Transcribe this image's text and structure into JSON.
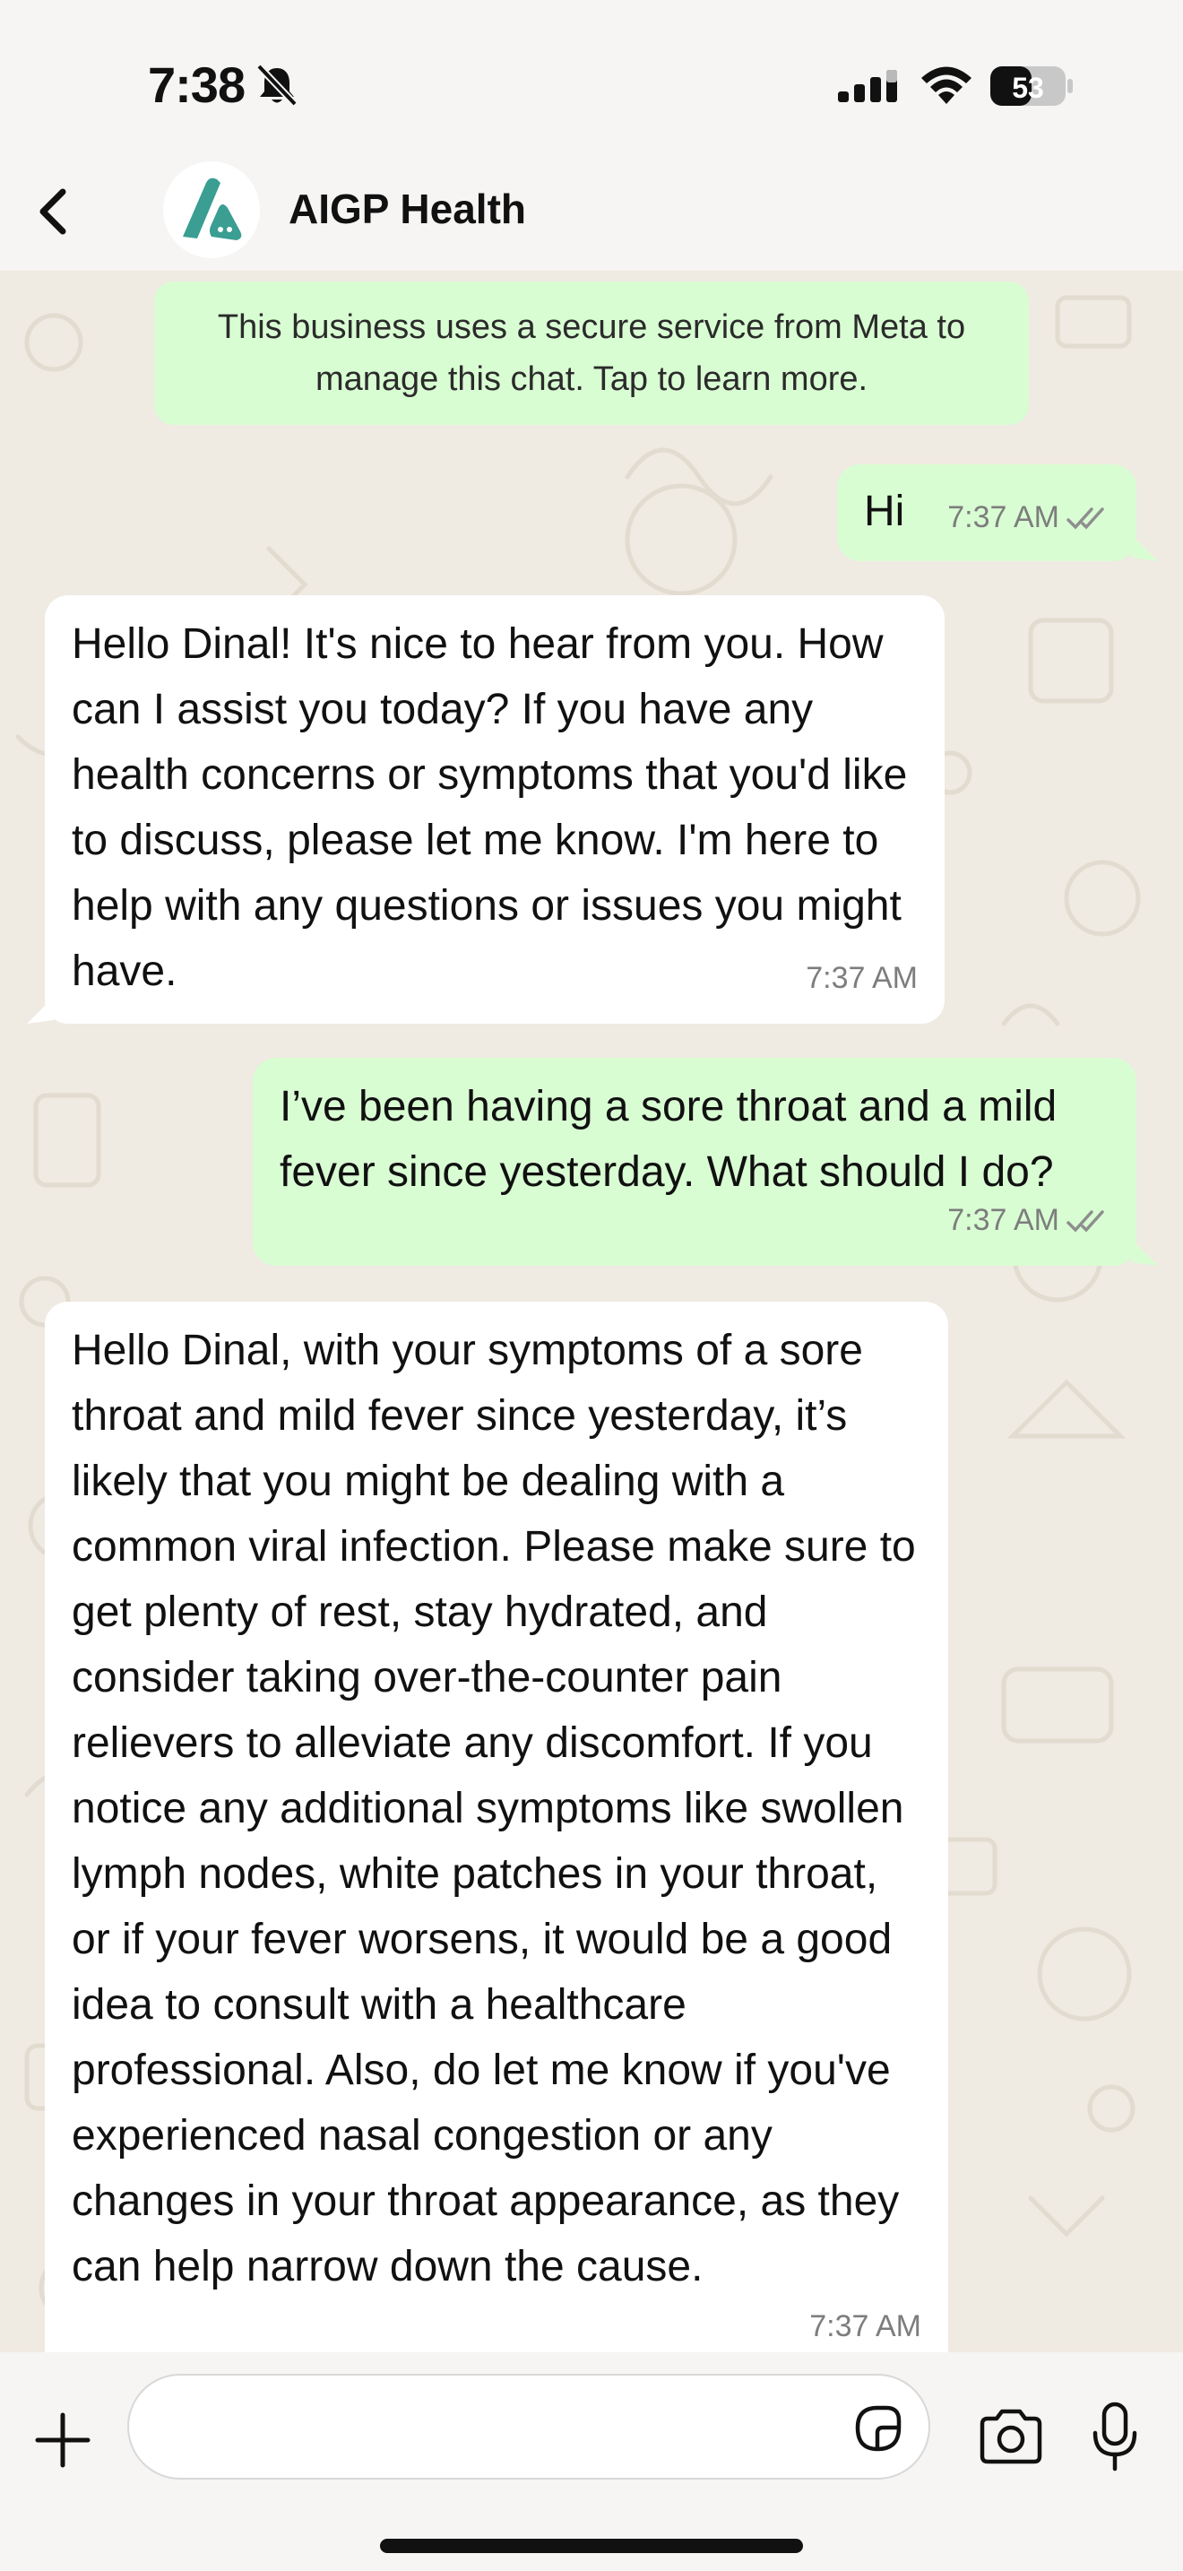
{
  "status_bar": {
    "time": "7:38",
    "battery_level": "53"
  },
  "header": {
    "title": "AIGP Health"
  },
  "notice": {
    "text": "This business uses a secure service from Meta to manage this chat. Tap to learn more."
  },
  "messages": [
    {
      "direction": "outgoing",
      "text": "Hi",
      "time": "7:37 AM",
      "status": "read"
    },
    {
      "direction": "incoming",
      "text": "Hello Dinal! It's nice to hear from you. How can I assist you today? If you have any health concerns or symptoms that you'd like to discuss, please let me know. I'm here to help with any questions or issues you might have.",
      "time": "7:37 AM"
    },
    {
      "direction": "outgoing",
      "text": "I’ve been having a sore throat and a mild fever since yesterday. What should I do?",
      "time": "7:37 AM",
      "status": "read"
    },
    {
      "direction": "incoming",
      "text": "Hello Dinal, with your symptoms of a sore throat and mild fever since yesterday, it’s likely that you might be dealing with a common viral infection. Please make sure to get plenty of rest, stay hydrated, and consider taking over-the-counter pain relievers to alleviate any discomfort. If you notice any additional symptoms like swollen lymph nodes, white patches in your throat, or if your fever worsens, it would be a good idea to consult with a healthcare professional. Also, do let me know if you've experienced nasal congestion or any changes in your throat appearance, as they can help narrow down the cause.",
      "time": "7:37 AM"
    }
  ],
  "composer": {
    "input_value": ""
  },
  "colors": {
    "outgoing_bubble": "#d9fdd3",
    "incoming_bubble": "#ffffff",
    "chat_background": "#efeae2",
    "read_ticks": "#8e8e8e",
    "brand_teal": "#3a9e92"
  },
  "icons": [
    "back-chevron-icon",
    "silent-bell-icon",
    "cellular-signal-icon",
    "wifi-icon",
    "battery-icon",
    "plus-icon",
    "sticker-icon",
    "camera-icon",
    "microphone-icon",
    "double-check-icon"
  ]
}
